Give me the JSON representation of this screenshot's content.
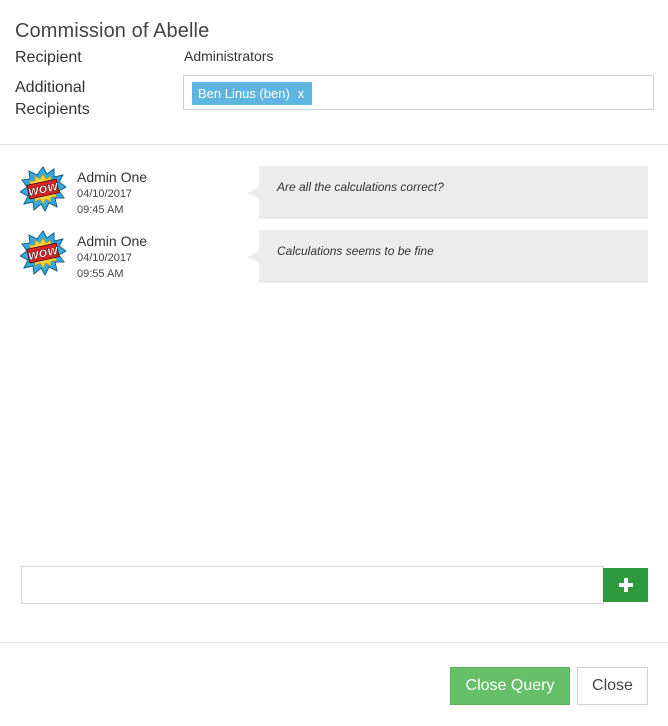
{
  "dialog": {
    "title": "Commission of Abelle",
    "recipient_label": "Recipient",
    "recipient_value": "Administrators",
    "additional_recipients_label": "Additional Recipients",
    "additional_recipients": [
      {
        "label": "Ben Linus (ben)",
        "remove_label": "x"
      }
    ]
  },
  "messages": [
    {
      "author": "Admin One",
      "date": "04/10/2017",
      "time": "09:45 AM",
      "avatar_icon": "wow-comic-burst-icon",
      "text": "Are all the calculations correct?"
    },
    {
      "author": "Admin One",
      "date": "04/10/2017",
      "time": "09:55 AM",
      "avatar_icon": "wow-comic-burst-icon",
      "text": "Calculations seems to be fine"
    }
  ],
  "compose": {
    "value": "",
    "placeholder": "",
    "add_icon": "plus-icon"
  },
  "footer": {
    "close_query_label": "Close Query",
    "close_label": "Close"
  },
  "colors": {
    "tag_bg": "#5eb5e0",
    "add_button": "#2e9a3e",
    "close_query_button": "#66bf69",
    "bubble_bg": "#ececec"
  }
}
